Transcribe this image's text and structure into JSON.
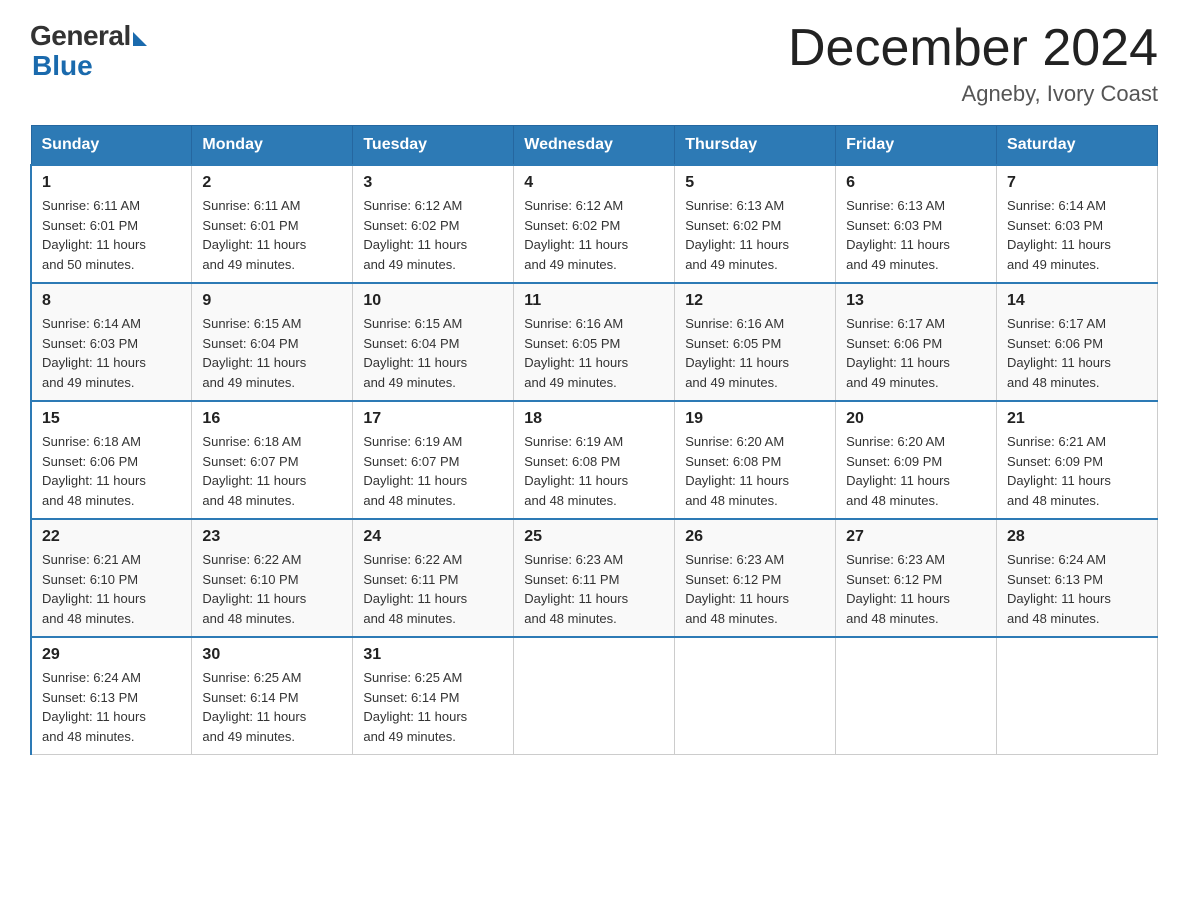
{
  "logo": {
    "general": "General",
    "blue": "Blue"
  },
  "title": "December 2024",
  "subtitle": "Agneby, Ivory Coast",
  "weekdays": [
    "Sunday",
    "Monday",
    "Tuesday",
    "Wednesday",
    "Thursday",
    "Friday",
    "Saturday"
  ],
  "weeks": [
    [
      {
        "day": "1",
        "info": "Sunrise: 6:11 AM\nSunset: 6:01 PM\nDaylight: 11 hours\nand 50 minutes."
      },
      {
        "day": "2",
        "info": "Sunrise: 6:11 AM\nSunset: 6:01 PM\nDaylight: 11 hours\nand 49 minutes."
      },
      {
        "day": "3",
        "info": "Sunrise: 6:12 AM\nSunset: 6:02 PM\nDaylight: 11 hours\nand 49 minutes."
      },
      {
        "day": "4",
        "info": "Sunrise: 6:12 AM\nSunset: 6:02 PM\nDaylight: 11 hours\nand 49 minutes."
      },
      {
        "day": "5",
        "info": "Sunrise: 6:13 AM\nSunset: 6:02 PM\nDaylight: 11 hours\nand 49 minutes."
      },
      {
        "day": "6",
        "info": "Sunrise: 6:13 AM\nSunset: 6:03 PM\nDaylight: 11 hours\nand 49 minutes."
      },
      {
        "day": "7",
        "info": "Sunrise: 6:14 AM\nSunset: 6:03 PM\nDaylight: 11 hours\nand 49 minutes."
      }
    ],
    [
      {
        "day": "8",
        "info": "Sunrise: 6:14 AM\nSunset: 6:03 PM\nDaylight: 11 hours\nand 49 minutes."
      },
      {
        "day": "9",
        "info": "Sunrise: 6:15 AM\nSunset: 6:04 PM\nDaylight: 11 hours\nand 49 minutes."
      },
      {
        "day": "10",
        "info": "Sunrise: 6:15 AM\nSunset: 6:04 PM\nDaylight: 11 hours\nand 49 minutes."
      },
      {
        "day": "11",
        "info": "Sunrise: 6:16 AM\nSunset: 6:05 PM\nDaylight: 11 hours\nand 49 minutes."
      },
      {
        "day": "12",
        "info": "Sunrise: 6:16 AM\nSunset: 6:05 PM\nDaylight: 11 hours\nand 49 minutes."
      },
      {
        "day": "13",
        "info": "Sunrise: 6:17 AM\nSunset: 6:06 PM\nDaylight: 11 hours\nand 49 minutes."
      },
      {
        "day": "14",
        "info": "Sunrise: 6:17 AM\nSunset: 6:06 PM\nDaylight: 11 hours\nand 48 minutes."
      }
    ],
    [
      {
        "day": "15",
        "info": "Sunrise: 6:18 AM\nSunset: 6:06 PM\nDaylight: 11 hours\nand 48 minutes."
      },
      {
        "day": "16",
        "info": "Sunrise: 6:18 AM\nSunset: 6:07 PM\nDaylight: 11 hours\nand 48 minutes."
      },
      {
        "day": "17",
        "info": "Sunrise: 6:19 AM\nSunset: 6:07 PM\nDaylight: 11 hours\nand 48 minutes."
      },
      {
        "day": "18",
        "info": "Sunrise: 6:19 AM\nSunset: 6:08 PM\nDaylight: 11 hours\nand 48 minutes."
      },
      {
        "day": "19",
        "info": "Sunrise: 6:20 AM\nSunset: 6:08 PM\nDaylight: 11 hours\nand 48 minutes."
      },
      {
        "day": "20",
        "info": "Sunrise: 6:20 AM\nSunset: 6:09 PM\nDaylight: 11 hours\nand 48 minutes."
      },
      {
        "day": "21",
        "info": "Sunrise: 6:21 AM\nSunset: 6:09 PM\nDaylight: 11 hours\nand 48 minutes."
      }
    ],
    [
      {
        "day": "22",
        "info": "Sunrise: 6:21 AM\nSunset: 6:10 PM\nDaylight: 11 hours\nand 48 minutes."
      },
      {
        "day": "23",
        "info": "Sunrise: 6:22 AM\nSunset: 6:10 PM\nDaylight: 11 hours\nand 48 minutes."
      },
      {
        "day": "24",
        "info": "Sunrise: 6:22 AM\nSunset: 6:11 PM\nDaylight: 11 hours\nand 48 minutes."
      },
      {
        "day": "25",
        "info": "Sunrise: 6:23 AM\nSunset: 6:11 PM\nDaylight: 11 hours\nand 48 minutes."
      },
      {
        "day": "26",
        "info": "Sunrise: 6:23 AM\nSunset: 6:12 PM\nDaylight: 11 hours\nand 48 minutes."
      },
      {
        "day": "27",
        "info": "Sunrise: 6:23 AM\nSunset: 6:12 PM\nDaylight: 11 hours\nand 48 minutes."
      },
      {
        "day": "28",
        "info": "Sunrise: 6:24 AM\nSunset: 6:13 PM\nDaylight: 11 hours\nand 48 minutes."
      }
    ],
    [
      {
        "day": "29",
        "info": "Sunrise: 6:24 AM\nSunset: 6:13 PM\nDaylight: 11 hours\nand 48 minutes."
      },
      {
        "day": "30",
        "info": "Sunrise: 6:25 AM\nSunset: 6:14 PM\nDaylight: 11 hours\nand 49 minutes."
      },
      {
        "day": "31",
        "info": "Sunrise: 6:25 AM\nSunset: 6:14 PM\nDaylight: 11 hours\nand 49 minutes."
      },
      null,
      null,
      null,
      null
    ]
  ]
}
